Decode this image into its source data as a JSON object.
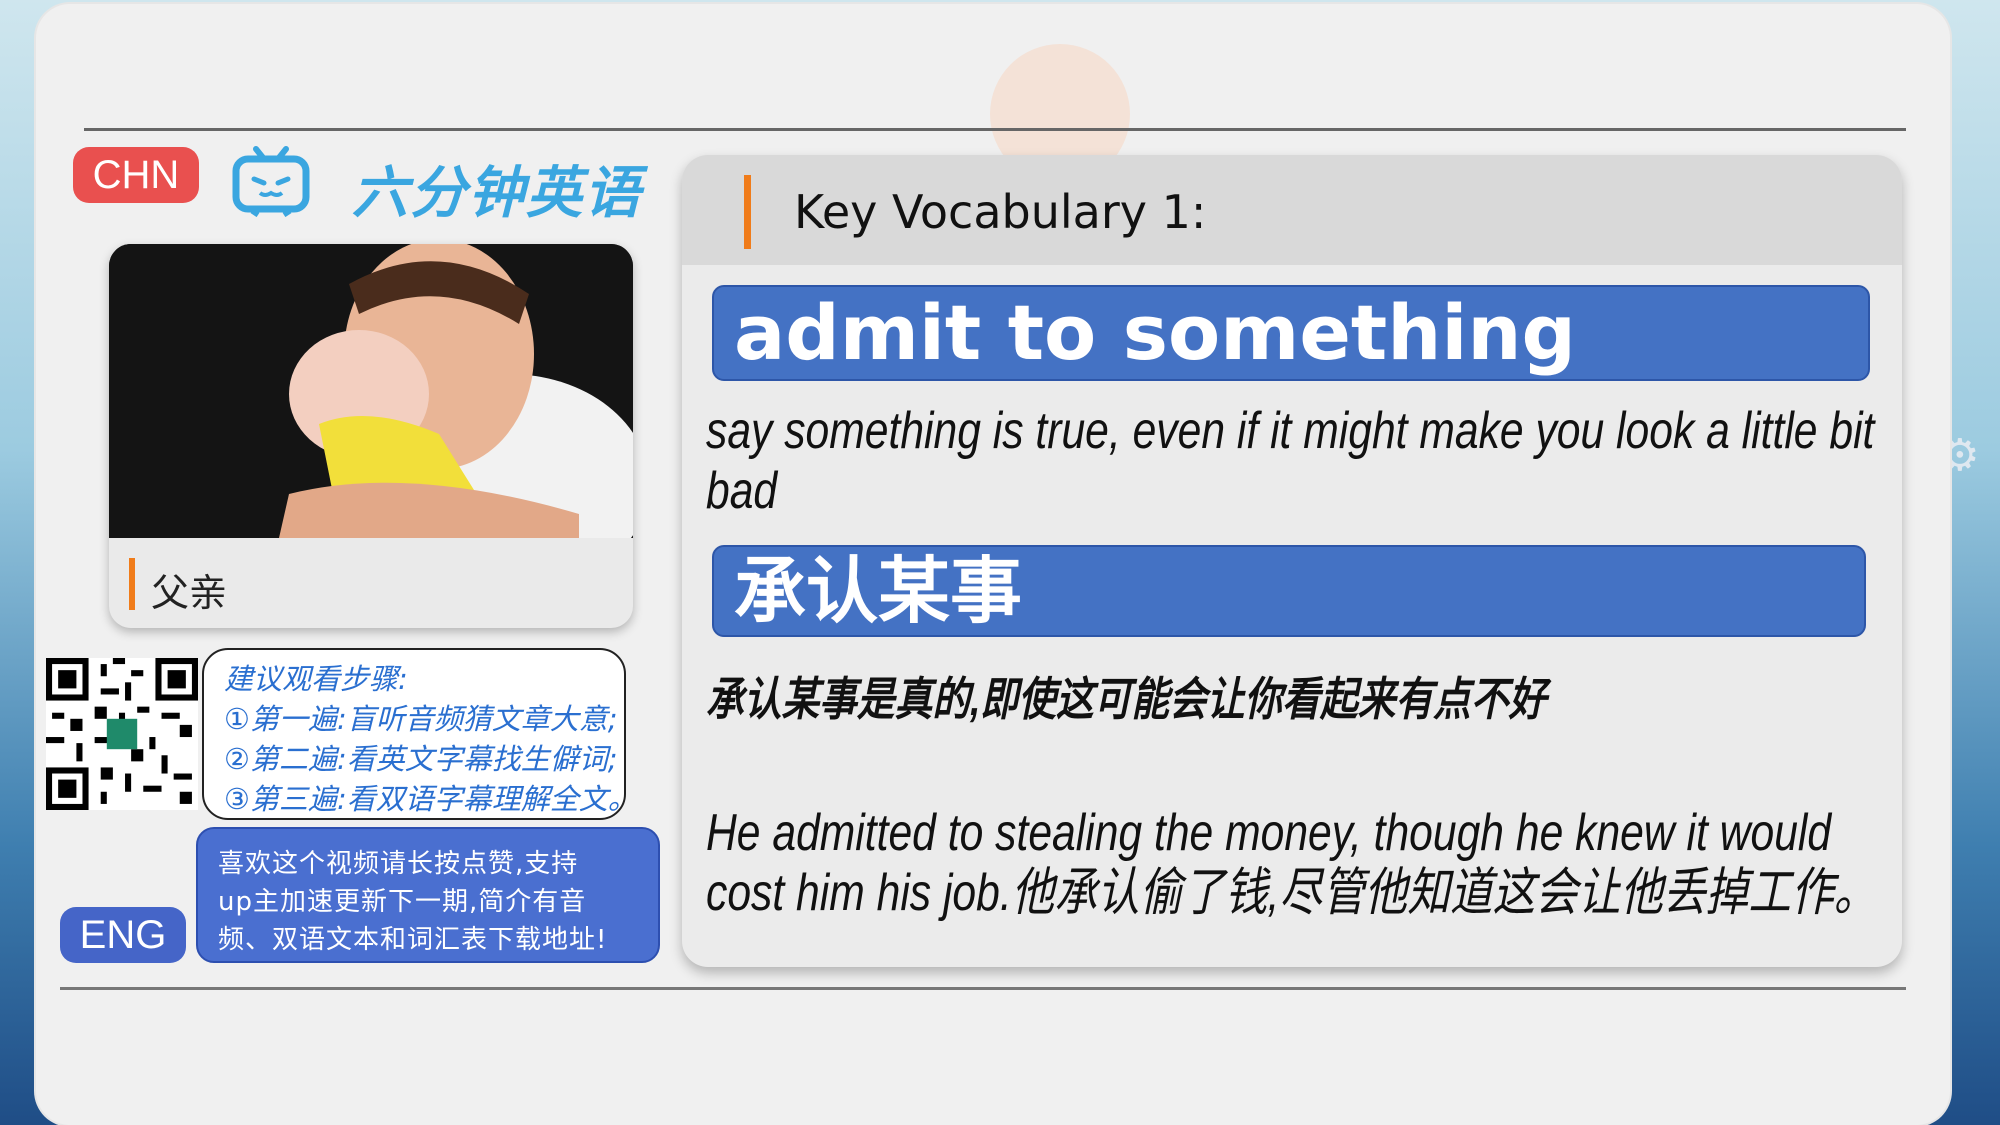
{
  "badges": {
    "chn": "CHN",
    "eng": "ENG"
  },
  "brand": {
    "title": "六分钟英语"
  },
  "photo": {
    "label": "父亲"
  },
  "tips": {
    "line1": "建议观看步骤:",
    "line2": "①第一遍:盲听音频猜文章大意;",
    "line3": "②第二遍:看英文字幕找生僻词;",
    "line4": "③第三遍:看双语字幕理解全文。"
  },
  "promo": {
    "line1": "喜欢这个视频请长按点赞,支持",
    "line2": "up主加速更新下一期,简介有音",
    "line3": "频、双语文本和词汇表下载地址!"
  },
  "vocab": {
    "heading": "Key Vocabulary 1:",
    "term_en": "admit to something",
    "definition_en_line1": "say something is true, even if it might make you look a little bit",
    "definition_en_line2": "bad",
    "term_zh": "承认某事",
    "definition_zh": "承认某事是真的,即使这可能会让你看起来有点不好",
    "example_line1": "He admitted to stealing the money, though he knew it would",
    "example_line2": "cost him his job.他承认偷了钱,尽管他知道这会让他丢掉工作。"
  },
  "colors": {
    "accent_orange": "#f07c1a",
    "band_blue": "#4472c4",
    "brand_blue": "#3aa6e0",
    "chn_red": "#e9504f"
  },
  "icons": [
    "bilibili-tv-icon",
    "qr-code",
    "star-sparkle-icon",
    "gear-icon"
  ]
}
